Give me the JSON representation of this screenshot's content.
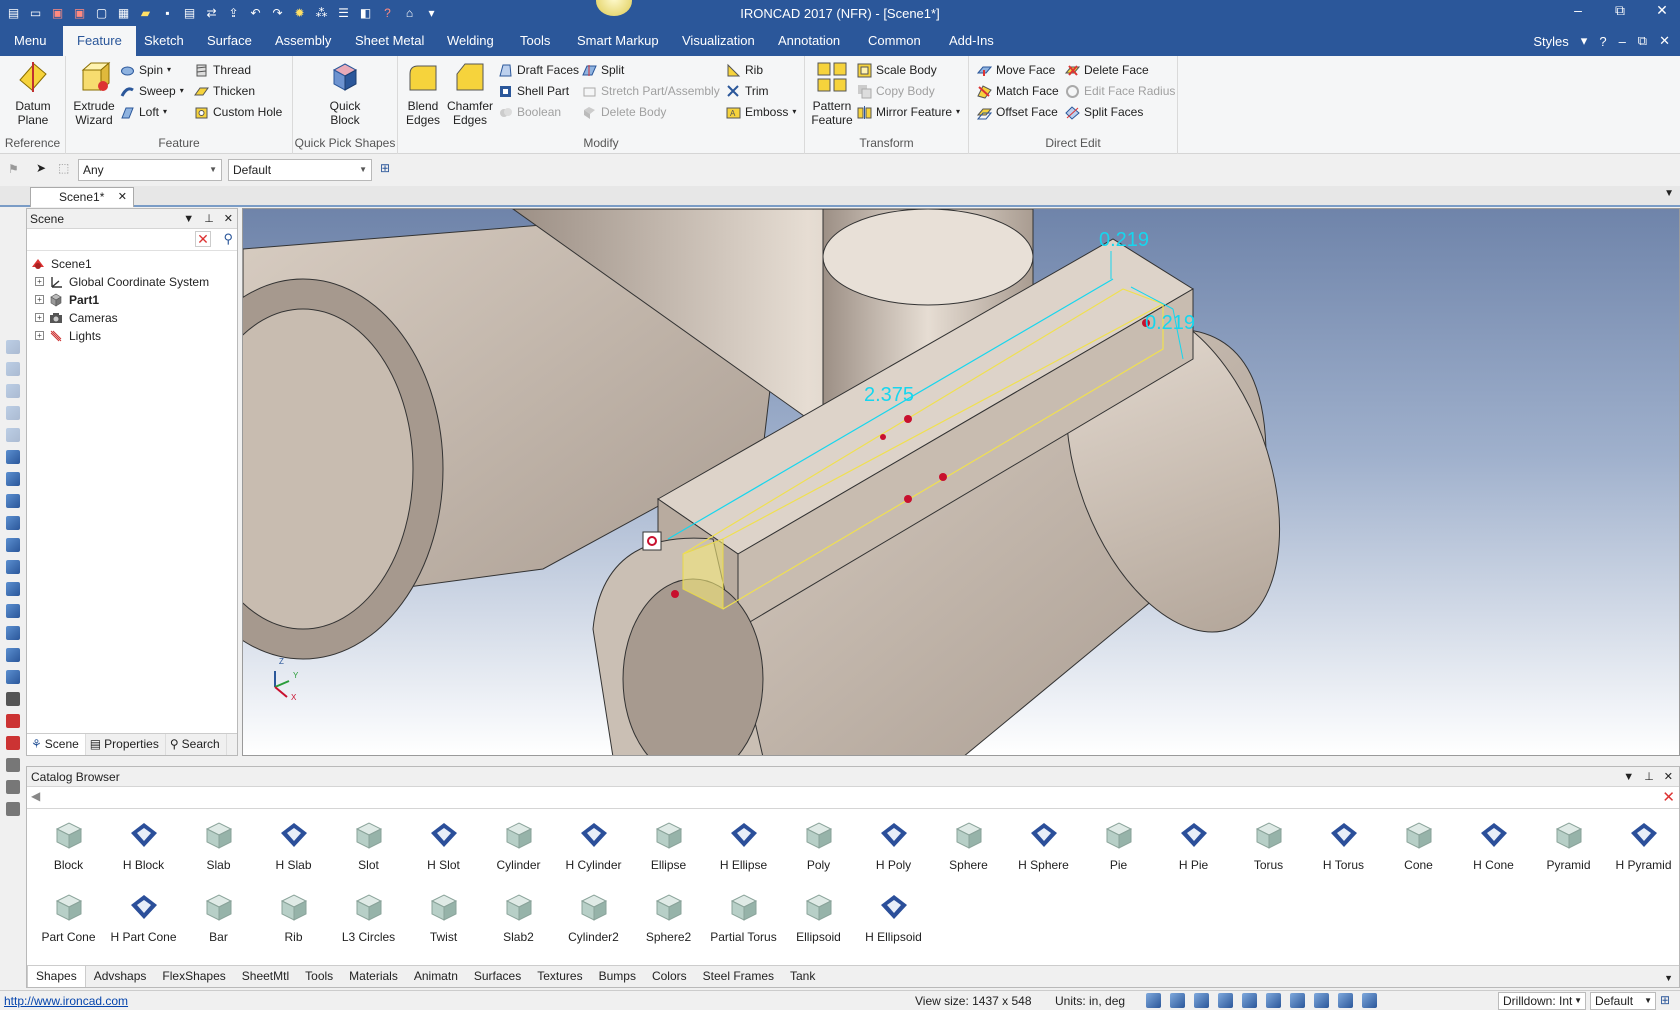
{
  "window": {
    "title": "IRONCAD 2017 (NFR) - [Scene1*]",
    "controls": [
      "–",
      "⧉",
      "✕"
    ]
  },
  "menu": {
    "tabs": [
      "Menu",
      "Feature",
      "Sketch",
      "Surface",
      "Assembly",
      "Sheet Metal",
      "Welding",
      "Tools",
      "Smart Markup",
      "Visualization",
      "Annotation",
      "Common",
      "Add-Ins"
    ],
    "active": "Feature",
    "styles_label": "Styles"
  },
  "ribbon": {
    "reference": {
      "label": "Reference",
      "datum": "Datum\nPlane"
    },
    "feature": {
      "label": "Feature",
      "extrude": "Extrude\nWizard",
      "spin": "Spin",
      "sweep": "Sweep",
      "loft": "Loft",
      "thread": "Thread",
      "thicken": "Thicken",
      "custom_hole": "Custom Hole"
    },
    "quick_pick": {
      "label": "Quick Pick Shapes",
      "quick_block": "Quick\nBlock"
    },
    "modify": {
      "label": "Modify",
      "blend": "Blend\nEdges",
      "chamfer": "Chamfer\nEdges",
      "draft_faces": "Draft Faces",
      "shell_part": "Shell Part",
      "boolean": "Boolean",
      "split": "Split",
      "stretch": "Stretch Part/Assembly",
      "delete_body": "Delete Body",
      "rib": "Rib",
      "trim": "Trim",
      "emboss": "Emboss"
    },
    "transform": {
      "label": "Transform",
      "pattern": "Pattern\nFeature",
      "scale_body": "Scale Body",
      "copy_body": "Copy Body",
      "mirror_feature": "Mirror Feature"
    },
    "direct_edit": {
      "label": "Direct Edit",
      "move_face": "Move Face",
      "match_face": "Match Face",
      "offset_face": "Offset Face",
      "delete_face": "Delete Face",
      "edit_face_radius": "Edit Face Radius",
      "split_faces": "Split Faces"
    }
  },
  "toolbar": {
    "filter": "Any",
    "style": "Default"
  },
  "document": {
    "tab": "Scene1*"
  },
  "scene_panel": {
    "title": "Scene",
    "tree": [
      {
        "label": "Scene1",
        "bold": false
      },
      {
        "label": "Global Coordinate System",
        "bold": false
      },
      {
        "label": "Part1",
        "bold": true
      },
      {
        "label": "Cameras",
        "bold": false
      },
      {
        "label": "Lights",
        "bold": false
      }
    ],
    "tabs": [
      "Scene",
      "Properties",
      "Search"
    ]
  },
  "viewport": {
    "dimensions": {
      "width_top": "0.219",
      "width_side": "0.219",
      "length": "2.375"
    },
    "triad": {
      "z": "Z",
      "y": "Y",
      "x": "X"
    }
  },
  "catalog": {
    "title": "Catalog Browser",
    "row1": [
      "Block",
      "H Block",
      "Slab",
      "H Slab",
      "Slot",
      "H Slot",
      "Cylinder",
      "H Cylinder",
      "Ellipse",
      "H Ellipse",
      "Poly",
      "H Poly",
      "Sphere",
      "H Sphere",
      "Pie",
      "H Pie",
      "Torus",
      "H Torus",
      "Cone",
      "H Cone",
      "Pyramid",
      "H Pyramid"
    ],
    "row2": [
      "Part Cone",
      "H Part Cone",
      "Bar",
      "Rib",
      "L3 Circles",
      "Twist",
      "Slab2",
      "Cylinder2",
      "Sphere2",
      "Partial Torus",
      "Ellipsoid",
      "H Ellipsoid"
    ],
    "tabs": [
      "Shapes",
      "Advshaps",
      "FlexShapes",
      "SheetMtl",
      "Tools",
      "Materials",
      "Animatn",
      "Surfaces",
      "Textures",
      "Bumps",
      "Colors",
      "Steel Frames",
      "Tank"
    ]
  },
  "status": {
    "url": "http://www.ironcad.com",
    "view_size": "View size: 1437 x  548",
    "units": "Units: in, deg",
    "drilldown": "Drilldown: Int",
    "style": "Default"
  },
  "colors": {
    "accent": "#2b579a",
    "dimension": "#16d6ee",
    "part": "#c9bdb2"
  }
}
